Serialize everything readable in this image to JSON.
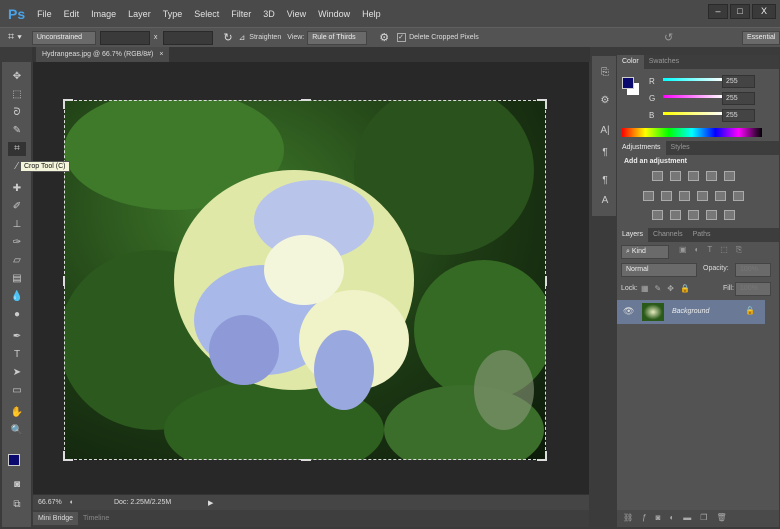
{
  "app": {
    "logo": "Ps",
    "menus": [
      "File",
      "Edit",
      "Image",
      "Layer",
      "Type",
      "Select",
      "Filter",
      "3D",
      "View",
      "Window",
      "Help"
    ],
    "window_buttons": [
      "–",
      "□",
      "X"
    ]
  },
  "options": {
    "ratio": "Unconstrained",
    "x_label": "x",
    "straighten": "Straighten",
    "view_label": "View:",
    "view_value": "Rule of Thirds",
    "delete_cropped": "Delete Cropped Pixels",
    "delete_checked": true,
    "workspace": "Essential"
  },
  "document": {
    "tab": "Hydrangeas.jpg @ 66.7% (RGB/8#)",
    "close": "×",
    "zoom": "66.67%",
    "doc_info": "Doc: 2.25M/2.25M"
  },
  "tooltip": "Crop Tool (C)",
  "bottom_tabs": [
    "Mini Bridge",
    "Timeline"
  ],
  "color_panel": {
    "tabs": [
      "Color",
      "Swatches"
    ],
    "channels": [
      {
        "label": "R",
        "value": "255"
      },
      {
        "label": "G",
        "value": "255"
      },
      {
        "label": "B",
        "value": "255"
      }
    ],
    "foreground": "#0a0a6e",
    "background": "#ffffff"
  },
  "adjustments_panel": {
    "tabs": [
      "Adjustments",
      "Styles"
    ],
    "heading": "Add an adjustment"
  },
  "layers_panel": {
    "tabs": [
      "Layers",
      "Channels",
      "Paths"
    ],
    "kind": "Kind",
    "blend_mode": "Normal",
    "opacity_label": "Opacity:",
    "opacity": "100%",
    "lock_label": "Lock:",
    "fill_label": "Fill:",
    "fill": "100%",
    "layers": [
      {
        "name": "Background",
        "visible": true,
        "locked": true
      }
    ]
  }
}
